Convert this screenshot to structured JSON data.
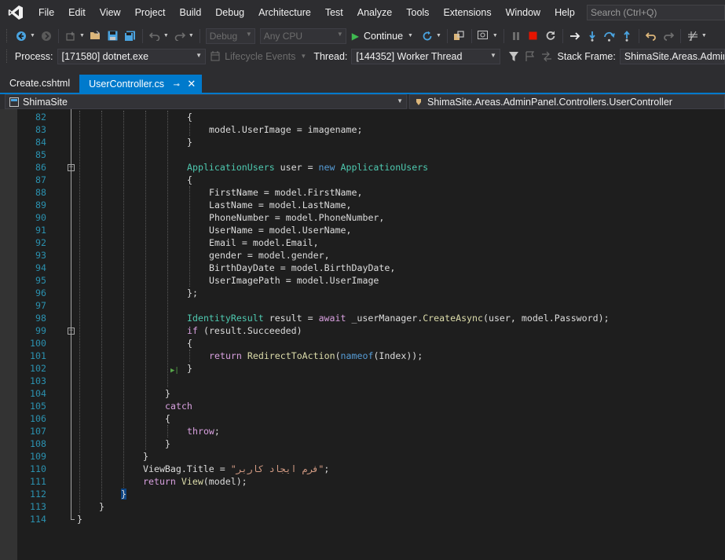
{
  "menu": {
    "items": [
      "File",
      "Edit",
      "View",
      "Project",
      "Build",
      "Debug",
      "Architecture",
      "Test",
      "Analyze",
      "Tools",
      "Extensions",
      "Window",
      "Help"
    ],
    "search_placeholder": "Search (Ctrl+Q)"
  },
  "toolbar": {
    "configuration": "Debug",
    "platform": "Any CPU",
    "continue_label": "Continue"
  },
  "debug_location": {
    "process_label": "Process:",
    "process_value": "[171580] dotnet.exe",
    "lifecycle_label": "Lifecycle Events",
    "thread_label": "Thread:",
    "thread_value": "[144352] Worker Thread",
    "stack_frame_label": "Stack Frame:",
    "stack_frame_value": "ShimaSite.Areas.AdminPanel.Controllers.UserController"
  },
  "tabs": [
    {
      "label": "Create.cshtml",
      "active": false
    },
    {
      "label": "UserController.cs",
      "active": true
    }
  ],
  "navigation": {
    "project": "ShimaSite",
    "type": "ShimaSite.Areas.AdminPanel.Controllers.UserController"
  },
  "editor": {
    "lines": [
      {
        "n": "82",
        "text": "{"
      },
      {
        "n": "83",
        "text": "model.UserImage = imagename;"
      },
      {
        "n": "84",
        "text": "}"
      },
      {
        "n": "85",
        "text": ""
      },
      {
        "n": "86",
        "text": "ApplicationUsers user = new ApplicationUsers"
      },
      {
        "n": "87",
        "text": "{"
      },
      {
        "n": "88",
        "text": "FirstName = model.FirstName,"
      },
      {
        "n": "89",
        "text": "LastName = model.LastName,"
      },
      {
        "n": "90",
        "text": "PhoneNumber = model.PhoneNumber,"
      },
      {
        "n": "91",
        "text": "UserName = model.UserName,"
      },
      {
        "n": "92",
        "text": "Email = model.Email,"
      },
      {
        "n": "93",
        "text": "gender = model.gender,"
      },
      {
        "n": "94",
        "text": "BirthDayDate = model.BirthDayDate,"
      },
      {
        "n": "95",
        "text": "UserImagePath = model.UserImage"
      },
      {
        "n": "96",
        "text": "};"
      },
      {
        "n": "97",
        "text": ""
      },
      {
        "n": "98",
        "text": "IdentityResult result = await _userManager.CreateAsync(user, model.Password);"
      },
      {
        "n": "99",
        "text": "if (result.Succeeded)"
      },
      {
        "n": "100",
        "text": "{"
      },
      {
        "n": "101",
        "text": "return RedirectToAction(nameof(Index));"
      },
      {
        "n": "102",
        "text": "}"
      },
      {
        "n": "103",
        "text": ""
      },
      {
        "n": "104",
        "text": "}"
      },
      {
        "n": "105",
        "text": "catch"
      },
      {
        "n": "106",
        "text": "{"
      },
      {
        "n": "107",
        "text": "throw;"
      },
      {
        "n": "108",
        "text": "}"
      },
      {
        "n": "109",
        "text": "}"
      },
      {
        "n": "110",
        "text": "ViewBag.Title = \"فرم ایجاد کاربر\";"
      },
      {
        "n": "111",
        "text": "return View(model);"
      },
      {
        "n": "112",
        "text": "}"
      },
      {
        "n": "113",
        "text": "}"
      },
      {
        "n": "114",
        "text": "}"
      }
    ]
  },
  "colors": {
    "accent": "#007acc",
    "line_number": "#2b91af",
    "keyword": "#569cd6",
    "type": "#4ec9b0",
    "method": "#dcdcaa",
    "string": "#d69d85",
    "control": "#d8a0df",
    "play": "#3fb950",
    "stop": "#e51400"
  }
}
